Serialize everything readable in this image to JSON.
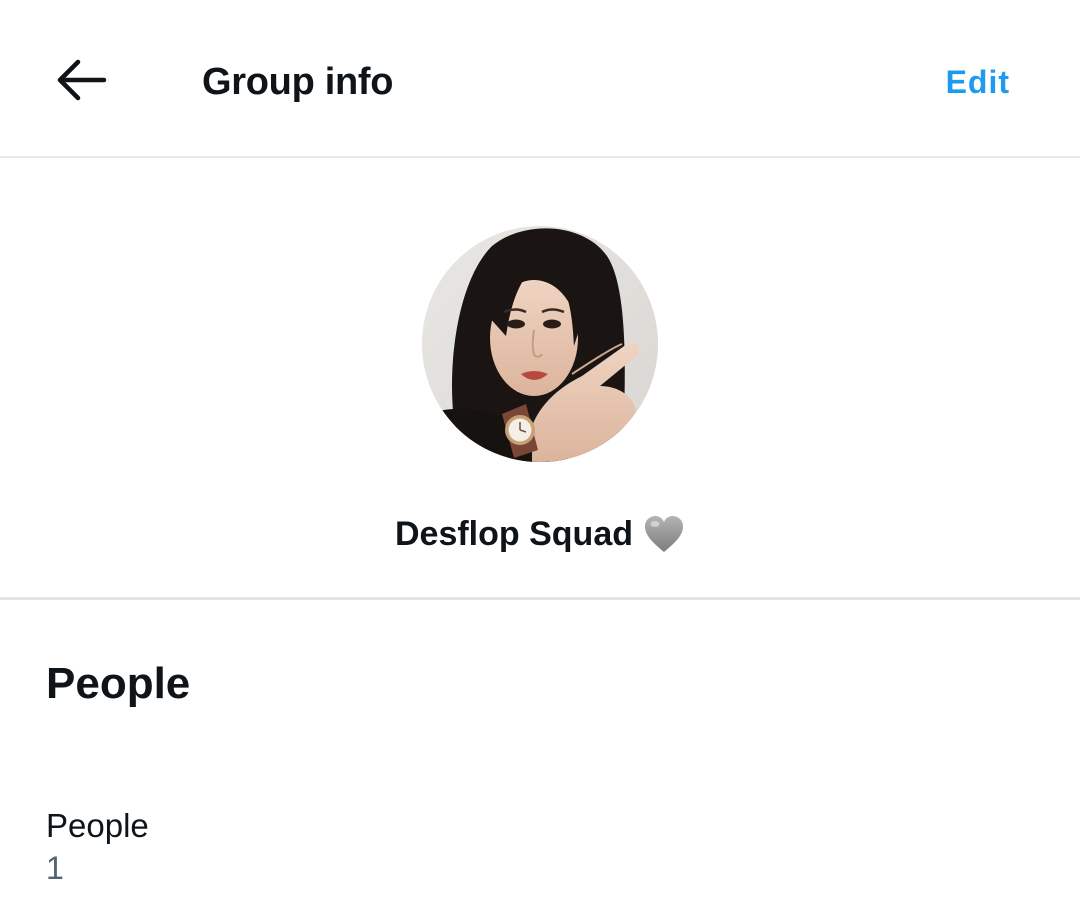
{
  "header": {
    "title": "Group info",
    "edit_label": "Edit",
    "back_icon": "arrow-left-icon"
  },
  "group": {
    "name": "Desflop Squad",
    "name_emoji": "grey-heart-icon",
    "avatar": "group-avatar-photo"
  },
  "people_section": {
    "heading": "People",
    "row_label": "People",
    "count": "1"
  },
  "colors": {
    "accent": "#1d9bf0",
    "text_primary": "#0f1419",
    "text_secondary": "#536471",
    "divider": "#e6e8ea"
  }
}
